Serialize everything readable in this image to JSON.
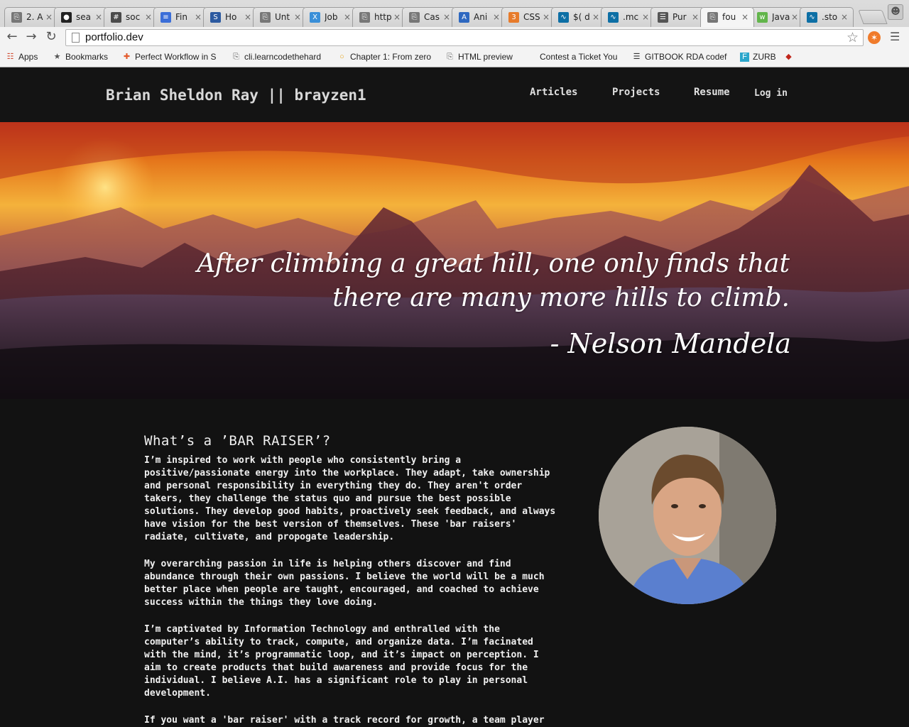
{
  "browser": {
    "tabs": [
      {
        "label": "2. A",
        "icon": "page-icon",
        "color": "#777"
      },
      {
        "label": "sea",
        "icon": "github-icon",
        "color": "#222"
      },
      {
        "label": "soc",
        "icon": "hash-icon",
        "color": "#4b4b4b"
      },
      {
        "label": "Fin",
        "icon": "doc-icon",
        "color": "#3b6ed8"
      },
      {
        "label": "Ho",
        "icon": "s-icon",
        "color": "#2c5aa0"
      },
      {
        "label": "Unt",
        "icon": "page-icon",
        "color": "#777"
      },
      {
        "label": "Job",
        "icon": "x-icon",
        "color": "#3a8fd8"
      },
      {
        "label": "http",
        "icon": "page-icon",
        "color": "#777"
      },
      {
        "label": "Cas",
        "icon": "page-icon",
        "color": "#777"
      },
      {
        "label": "Ani",
        "icon": "a-icon",
        "color": "#2e68c0"
      },
      {
        "label": "CSS",
        "icon": "css-icon",
        "color": "#e77b2b"
      },
      {
        "label": "$( d",
        "icon": "jquery-icon",
        "color": "#0d6fa5"
      },
      {
        "label": ".mc",
        "icon": "jquery-icon",
        "color": "#0d6fa5"
      },
      {
        "label": "Pur",
        "icon": "book-icon",
        "color": "#555"
      },
      {
        "label": "fou",
        "icon": "page-icon",
        "color": "#777"
      },
      {
        "label": "Java",
        "icon": "w3-icon",
        "color": "#62b54b"
      },
      {
        "label": ".sto",
        "icon": "jquery-icon",
        "color": "#0d6fa5"
      }
    ],
    "active_tab": 14,
    "url": "portfolio.dev",
    "bookmarks": [
      {
        "label": "Apps",
        "icon": "apps-icon"
      },
      {
        "label": "Bookmarks",
        "icon": "star-icon"
      },
      {
        "label": "Perfect Workflow in S",
        "icon": "plus-icon"
      },
      {
        "label": "cli.learncodethehard",
        "icon": "page-icon"
      },
      {
        "label": "Chapter 1: From zero",
        "icon": "circle-icon"
      },
      {
        "label": "HTML preview",
        "icon": "page-icon"
      },
      {
        "label": "Contest a Ticket You",
        "icon": "blank-icon"
      },
      {
        "label": "GITBOOK RDA codef",
        "icon": "book-icon"
      },
      {
        "label": "ZURB",
        "icon": "foundation-icon"
      },
      {
        "label": "",
        "icon": "ruby-icon"
      }
    ]
  },
  "site": {
    "brand": "Brian Sheldon Ray || brayzen1",
    "nav": [
      "Articles",
      "Projects",
      "Resume",
      "Log in"
    ],
    "quote": "After climbing a great hill, one only finds that\nthere are many more hills to climb.",
    "attribution": "- Nelson Mandela",
    "about_title": "What’s a ’BAR RAISER’?",
    "paragraphs": [
      "I’m inspired to work with people who consistently bring a\npositive/passionate energy into the workplace. They adapt, take ownership\nand personal responsibility in everything they do. They aren't order\ntakers, they challenge the status quo and pursue the best possible\nsolutions. They develop good habits, proactively seek feedback, and always\nhave vision for the best version of themselves. These 'bar raisers'\nradiate, cultivate, and propogate leadership.",
      "My overarching passion in life is helping others discover and find\nabundance through their own passions. I believe the world will be a much\nbetter place when people are taught, encouraged, and coached to achieve\nsuccess within the things they love doing.",
      "I’m captivated by Information Technology and enthralled with the\ncomputer’s ability to track, compute, and organize data. I’m facinated\nwith the mind, it’s programmatic loop, and it’s impact on perception. I\naim to create products that build awareness and provide focus for the\nindividual. I believe A.I. has a significant role to play in personal\ndevelopment.",
      "If you want a 'bar raiser' with a track record for growth, a team player"
    ]
  }
}
